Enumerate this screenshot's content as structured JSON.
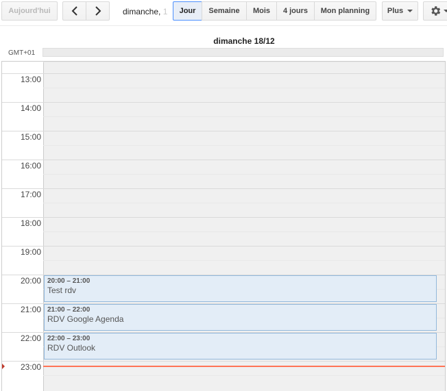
{
  "toolbar": {
    "today_label": "Aujourd'hui",
    "prev_icon": "chevron-left-icon",
    "next_icon": "chevron-right-icon",
    "date_range_visible": "dimanche, ",
    "date_range_faded": "1",
    "views": [
      {
        "label": "Jour",
        "selected": true
      },
      {
        "label": "Semaine",
        "selected": false
      },
      {
        "label": "Mois",
        "selected": false
      },
      {
        "label": "4 jours",
        "selected": false
      },
      {
        "label": "Mon planning",
        "selected": false
      }
    ],
    "more_label": "Plus",
    "settings_icon": "gear-icon"
  },
  "calendar": {
    "day_header": "dimanche 18/12",
    "timezone_label": "GMT+01",
    "hours": [
      "13:00",
      "14:00",
      "15:00",
      "16:00",
      "17:00",
      "18:00",
      "19:00",
      "20:00",
      "21:00",
      "22:00",
      "23:00"
    ],
    "events": [
      {
        "time": "20:00 – 21:00",
        "title": "Test rdv"
      },
      {
        "time": "21:00 – 22:00",
        "title": "RDV Google Agenda"
      },
      {
        "time": "22:00 – 23:00",
        "title": "RDV Outlook"
      }
    ],
    "current_time": "23:00"
  },
  "colors": {
    "event_bg": "#e3edf7",
    "event_border": "#92b8dc",
    "now_line": "#ff7455",
    "selected_view_border": "#4d90fe"
  }
}
